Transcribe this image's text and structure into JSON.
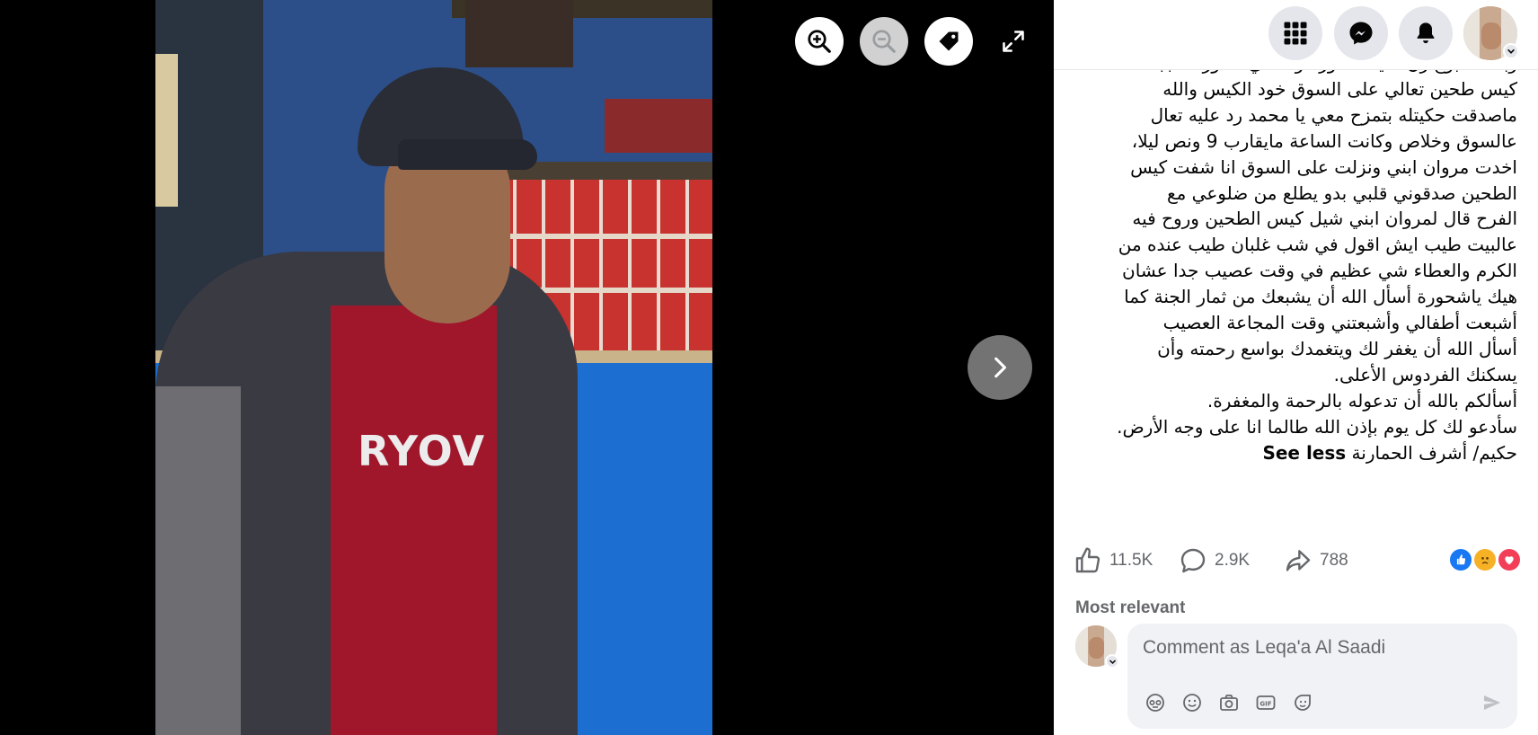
{
  "viewer": {
    "zoom_in": "zoom-in",
    "zoom_out": "zoom-out",
    "tag": "tag",
    "fullscreen": "fullscreen",
    "next": "next-photo",
    "shirt_text": "RYOV"
  },
  "post": {
    "lines": [
      "وبعد اسبوع رن عليه شحورة وحكالي دكتور انا جبتلك",
      "كيس طحين تعالي على السوق خود الكيس والله",
      "ماصدقت حكيتله بتمزح معي يا محمد رد عليه تعال",
      "عالسوق وخلاص وكانت الساعة مايقارب 9 ونص ليلا،",
      "اخدت مروان ابني ونزلت على السوق انا شفت كيس",
      "الطحين صدقوني قلبي بدو يطلع من ضلوعي مع",
      "الفرح قال لمروان ابني شيل كيس الطحين وروح فيه",
      "عالبيت طيب ايش اقول في شب غلبان طيب عنده من",
      "الكرم والعطاء شي عظيم في وقت عصيب جدا عشان",
      "هيك ياشحورة أسأل الله أن يشبعك من ثمار الجنة كما",
      "أشبعت أطفالي وأشبعتني وقت المجاعة العصيب",
      "أسأل الله أن يغفر لك ويتغمدك بواسع رحمته وأن",
      "يسكنك الفردوس الأعلى.",
      "أسألكم بالله أن تدعوله بالرحمة والمغفرة.",
      "سأدعو لك كل يوم بإذن الله طالما انا على وجه الأرض."
    ],
    "signature": "حكيم/ أشرف الحمارنة",
    "see_less": "See less"
  },
  "stats": {
    "likes": "11.5K",
    "comments": "2.9K",
    "shares": "788"
  },
  "sort_label": "Most relevant",
  "composer": {
    "placeholder": "Comment as Leqa'a Al Saadi"
  },
  "colors": {
    "like_blue": "#1877f2",
    "love_red": "#f33e58",
    "sad_yellow": "#f7b125",
    "icon_gray": "#65676b"
  }
}
